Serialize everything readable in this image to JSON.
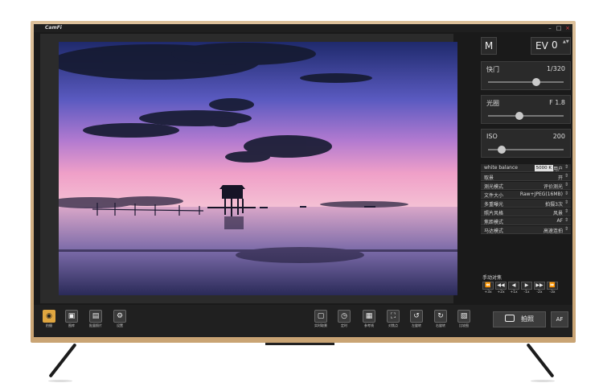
{
  "app": {
    "logo": "CamFi",
    "window_buttons": [
      "–",
      "□",
      "×"
    ]
  },
  "top_controls": {
    "mode": "M",
    "ev_label": "EV",
    "ev_value": "0",
    "ev_arrows": "▲▼"
  },
  "sliders": {
    "shutter": {
      "label": "快门",
      "value": "1/320",
      "level": 0.64
    },
    "aperture": {
      "label": "光圈",
      "value": "F 1.8",
      "level": 0.42
    },
    "iso": {
      "label": "ISO",
      "value": "200",
      "level": 0.18
    }
  },
  "settings": [
    {
      "key": "white balance",
      "wb": "5000 K",
      "value": "用户"
    },
    {
      "key": "取景",
      "value": "开"
    },
    {
      "key": "测光模式",
      "value": "评价测光"
    },
    {
      "key": "文件大小",
      "value": "Raw+JPEG(16MB)"
    },
    {
      "key": "多重曝光",
      "value": "拍摄3次"
    },
    {
      "key": "照片风格",
      "value": "风景"
    },
    {
      "key": "焦距模式",
      "value": "AF"
    },
    {
      "key": "马达模式",
      "value": "高速连拍"
    }
  ],
  "manual_focus": {
    "title": "手动对焦",
    "buttons": [
      {
        "icon": "⏪",
        "label": "+3x"
      },
      {
        "icon": "◀◀",
        "label": "+2x"
      },
      {
        "icon": "◀",
        "label": "+1x"
      },
      {
        "icon": "▶",
        "label": "-1x"
      },
      {
        "icon": "▶▶",
        "label": "-2x"
      },
      {
        "icon": "⏩",
        "label": "-3x"
      }
    ]
  },
  "toolbar": {
    "left": [
      {
        "icon": "◉",
        "label": "拍摄",
        "active": true
      },
      {
        "icon": "▣",
        "label": "图库"
      },
      {
        "icon": "▤",
        "label": "批量照片"
      },
      {
        "icon": "⚙",
        "label": "设置"
      }
    ],
    "right": [
      {
        "icon": "▢",
        "label": "实时取景"
      },
      {
        "icon": "◷",
        "label": "定时"
      },
      {
        "icon": "▦",
        "label": "参考线"
      },
      {
        "icon": "⛶",
        "label": "对焦点"
      },
      {
        "icon": "↺",
        "label": "左旋转"
      },
      {
        "icon": "↻",
        "label": "右旋转"
      },
      {
        "icon": "▧",
        "label": "比较图"
      }
    ],
    "shoot_label": "拍照",
    "af_label": "AF"
  },
  "colors": {
    "frame": "#d4b48a",
    "panel": "#2a2a2a",
    "accent": "#e0a640",
    "close": "#e04040"
  }
}
